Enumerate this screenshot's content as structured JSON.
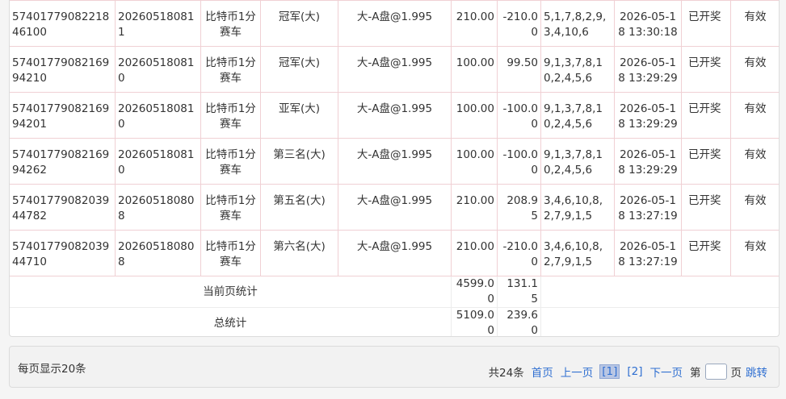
{
  "rows": [
    {
      "order_no": "5740177908221846100",
      "issue": "202605180811",
      "game": "比特币1分赛车",
      "play": "冠军(大)",
      "bet": "大-A盘@1.995",
      "amount": "210.00",
      "win_loss": "-210.00",
      "result": "5,1,7,8,2,9,3,4,10,6",
      "time": "2026-05-18 13:30:18",
      "status": "已开奖",
      "valid": "有效"
    },
    {
      "order_no": "5740177908216994210",
      "issue": "202605180810",
      "game": "比特币1分赛车",
      "play": "冠军(大)",
      "bet": "大-A盘@1.995",
      "amount": "100.00",
      "win_loss": "99.50",
      "result": "9,1,3,7,8,10,2,4,5,6",
      "time": "2026-05-18 13:29:29",
      "status": "已开奖",
      "valid": "有效"
    },
    {
      "order_no": "5740177908216994201",
      "issue": "202605180810",
      "game": "比特币1分赛车",
      "play": "亚军(大)",
      "bet": "大-A盘@1.995",
      "amount": "100.00",
      "win_loss": "-100.00",
      "result": "9,1,3,7,8,10,2,4,5,6",
      "time": "2026-05-18 13:29:29",
      "status": "已开奖",
      "valid": "有效"
    },
    {
      "order_no": "5740177908216994262",
      "issue": "202605180810",
      "game": "比特币1分赛车",
      "play": "第三名(大)",
      "bet": "大-A盘@1.995",
      "amount": "100.00",
      "win_loss": "-100.00",
      "result": "9,1,3,7,8,10,2,4,5,6",
      "time": "2026-05-18 13:29:29",
      "status": "已开奖",
      "valid": "有效"
    },
    {
      "order_no": "5740177908203944782",
      "issue": "202605180808",
      "game": "比特币1分赛车",
      "play": "第五名(大)",
      "bet": "大-A盘@1.995",
      "amount": "210.00",
      "win_loss": "208.95",
      "result": "3,4,6,10,8,2,7,9,1,5",
      "time": "2026-05-18 13:27:19",
      "status": "已开奖",
      "valid": "有效"
    },
    {
      "order_no": "5740177908203944710",
      "issue": "202605180808",
      "game": "比特币1分赛车",
      "play": "第六名(大)",
      "bet": "大-A盘@1.995",
      "amount": "210.00",
      "win_loss": "-210.00",
      "result": "3,4,6,10,8,2,7,9,1,5",
      "time": "2026-05-18 13:27:19",
      "status": "已开奖",
      "valid": "有效"
    }
  ],
  "summary": {
    "page_label": "当前页统计",
    "page_amount": "4599.00",
    "page_win_loss": "131.15",
    "total_label": "总统计",
    "total_amount": "5109.00",
    "total_win_loss": "239.60"
  },
  "pager": {
    "per_page": "每页显示20条",
    "total": "共24条",
    "first": "首页",
    "prev": "上一页",
    "page1": "[1]",
    "page2": "[2]",
    "next": "下一页",
    "goto_prefix": "第",
    "goto_suffix": "页",
    "jump": "跳转",
    "page_input_value": ""
  }
}
